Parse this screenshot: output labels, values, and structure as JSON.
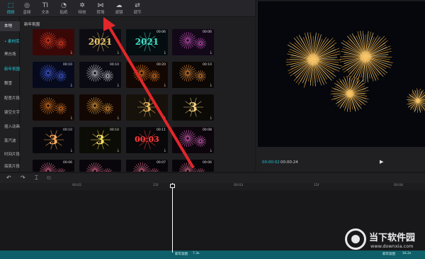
{
  "toolbar": {
    "items": [
      {
        "icon": "media-icon",
        "glyph": "⬚",
        "label": "视频",
        "active": true
      },
      {
        "icon": "audio-icon",
        "glyph": "◎",
        "label": "音频"
      },
      {
        "icon": "text-icon",
        "glyph": "TI",
        "label": "文本"
      },
      {
        "icon": "sticker-icon",
        "glyph": "◔",
        "label": "贴纸"
      },
      {
        "icon": "effects-icon",
        "glyph": "✲",
        "label": "特效"
      },
      {
        "icon": "transition-icon",
        "glyph": "⋈",
        "label": "转场"
      },
      {
        "icon": "filter-icon",
        "glyph": "☁",
        "label": "滤镜"
      },
      {
        "icon": "adjust-icon",
        "glyph": "⇄",
        "label": "调节"
      }
    ]
  },
  "sidebar": {
    "items": [
      {
        "label": "本地",
        "state": "sel"
      },
      {
        "label": "• 素材库",
        "state": "active"
      },
      {
        "label": "黑白场",
        "state": ""
      },
      {
        "label": "新年氛围",
        "state": "active"
      },
      {
        "label": "飘雪",
        "state": ""
      },
      {
        "label": "配意片段",
        "state": ""
      },
      {
        "label": "镂空文字",
        "state": ""
      },
      {
        "label": "插入动画",
        "state": ""
      },
      {
        "label": "蒸汽波",
        "state": ""
      },
      {
        "label": "时间片段",
        "state": ""
      },
      {
        "label": "搞笑片段",
        "state": ""
      }
    ]
  },
  "library": {
    "section_title": "新年氛围",
    "thumbs": [
      {
        "duration": "",
        "label": "",
        "style": "fw-red"
      },
      {
        "duration": "",
        "label": "2021",
        "style": "gold-text"
      },
      {
        "duration": "00:06",
        "label": "2021",
        "style": "teal-text"
      },
      {
        "duration": "00:06",
        "label": "",
        "style": "fw-pink"
      },
      {
        "duration": "00:10",
        "label": "",
        "style": "fw-blue"
      },
      {
        "duration": "00:10",
        "label": "",
        "style": "fw-white"
      },
      {
        "duration": "00:20",
        "label": "",
        "style": "fw-orange"
      },
      {
        "duration": "00:10",
        "label": "",
        "style": "fw-dark"
      },
      {
        "duration": "",
        "label": "",
        "style": "fw-orange"
      },
      {
        "duration": "",
        "label": "",
        "style": "fw-orange2"
      },
      {
        "duration": "",
        "label": "3",
        "style": "gold-3"
      },
      {
        "duration": "",
        "label": "3",
        "style": "gold-3b"
      },
      {
        "duration": "00:10",
        "label": "3",
        "style": "neon-3"
      },
      {
        "duration": "00:10",
        "label": "3",
        "style": "yellow-3"
      },
      {
        "duration": "00:11",
        "label": "00:03",
        "style": "red-digits"
      },
      {
        "duration": "00:08",
        "label": "",
        "style": "fw-pink2"
      },
      {
        "duration": "00:06",
        "label": "",
        "style": "fw-small"
      },
      {
        "duration": "",
        "label": "",
        "style": "fw-small"
      },
      {
        "duration": "00:07",
        "label": "",
        "style": "fw-small"
      },
      {
        "duration": "00:06",
        "label": "",
        "style": "fw-small"
      }
    ]
  },
  "preview": {
    "time_current": "00:00:02",
    "time_total": "00:00:24",
    "play_glyph": "▶"
  },
  "timeline": {
    "undo": "↶",
    "redo": "↷",
    "split": "⌶",
    "delete": "⧉",
    "ticks": [
      {
        "label": "00:02"
      },
      {
        "label": "15f"
      },
      {
        "label": "00:03"
      },
      {
        "label": "15f"
      },
      {
        "label": "00:04"
      }
    ],
    "clip_left": "新年氛围",
    "clip_left_dur": "7.3s",
    "clip_right": "新年氛围",
    "clip_right_dur": "16.2s"
  },
  "watermark": {
    "title": "当下软件园",
    "url": "www.downxia.com"
  },
  "colors": {
    "accent": "#20c7d4",
    "arrow": "#e3262a",
    "clip": "#0f5f6a"
  }
}
